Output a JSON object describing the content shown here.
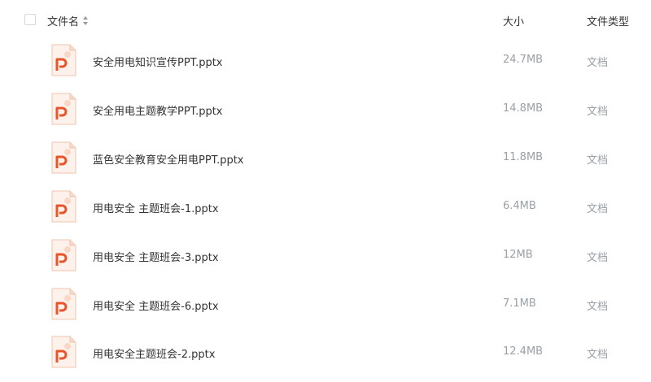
{
  "header": {
    "name_label": "文件名",
    "size_label": "大小",
    "type_label": "文件类型"
  },
  "icons": {
    "sort": "sort-icon",
    "file": "ppt-file-icon"
  },
  "colors": {
    "ppt_orange": "#e8552a",
    "ppt_bg": "#fdf1eb"
  },
  "files": [
    {
      "name": "安全用电知识宣传PPT.pptx",
      "size": "24.7MB",
      "type": "文档"
    },
    {
      "name": "安全用电主题教学PPT.pptx",
      "size": "14.8MB",
      "type": "文档"
    },
    {
      "name": "蓝色安全教育安全用电PPT.pptx",
      "size": "11.8MB",
      "type": "文档"
    },
    {
      "name": "用电安全 主题班会-1.pptx",
      "size": "6.4MB",
      "type": "文档"
    },
    {
      "name": "用电安全 主题班会-3.pptx",
      "size": "12MB",
      "type": "文档"
    },
    {
      "name": "用电安全 主题班会-6.pptx",
      "size": "7.1MB",
      "type": "文档"
    },
    {
      "name": "用电安全主题班会-2.pptx",
      "size": "12.4MB",
      "type": "文档"
    }
  ]
}
